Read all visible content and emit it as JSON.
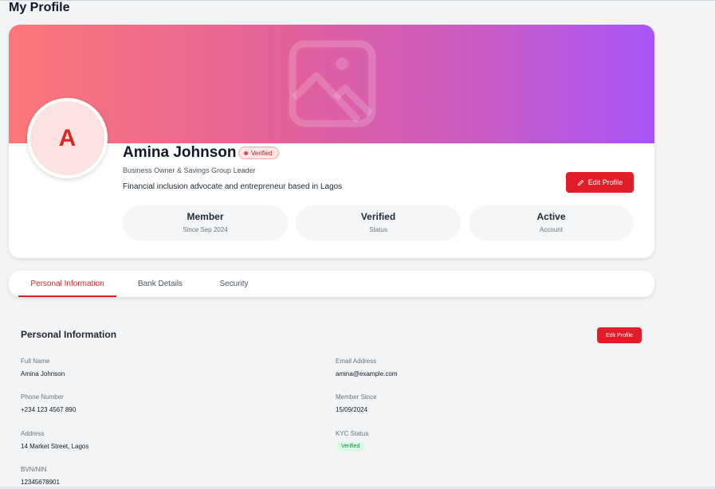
{
  "page": {
    "title": "My Profile"
  },
  "profile": {
    "avatar_initial": "A",
    "name": "Amina Johnson",
    "verified_badge": "Verified",
    "role": "Business Owner & Savings Group Leader",
    "bio": "Financial inclusion advocate and entrepreneur based in Lagos",
    "edit_button": "Edit Profile",
    "banner_icon": "image-placeholder-icon",
    "stats": [
      {
        "value": "Member",
        "label": "Since Sep 2024"
      },
      {
        "value": "Verified",
        "label": "Status"
      },
      {
        "value": "Active",
        "label": "Account"
      }
    ]
  },
  "tabs": [
    {
      "label": "Personal Information",
      "active": true
    },
    {
      "label": "Bank Details",
      "active": false
    },
    {
      "label": "Security",
      "active": false
    }
  ],
  "personal_info": {
    "title": "Personal Information",
    "edit_button": "Edit Profile",
    "fields": {
      "full_name": {
        "label": "Full Name",
        "value": "Amina Johnson"
      },
      "email": {
        "label": "Email Address",
        "value": "amina@example.com"
      },
      "phone": {
        "label": "Phone Number",
        "value": "+234 123 4567 890"
      },
      "member_since": {
        "label": "Member Since",
        "value": "15/09/2024"
      },
      "address": {
        "label": "Address",
        "value": "14 Market Street, Lagos"
      },
      "kyc": {
        "label": "KYC Status",
        "value": "Verified"
      },
      "bvn": {
        "label": "BVN/NIN",
        "value": "12345678901"
      }
    }
  },
  "colors": {
    "accent": "#e11d2a",
    "banner_start": "#fc7878",
    "banner_end": "#a855f7",
    "success_bg": "#dcfce7",
    "success_text": "#15803d"
  }
}
